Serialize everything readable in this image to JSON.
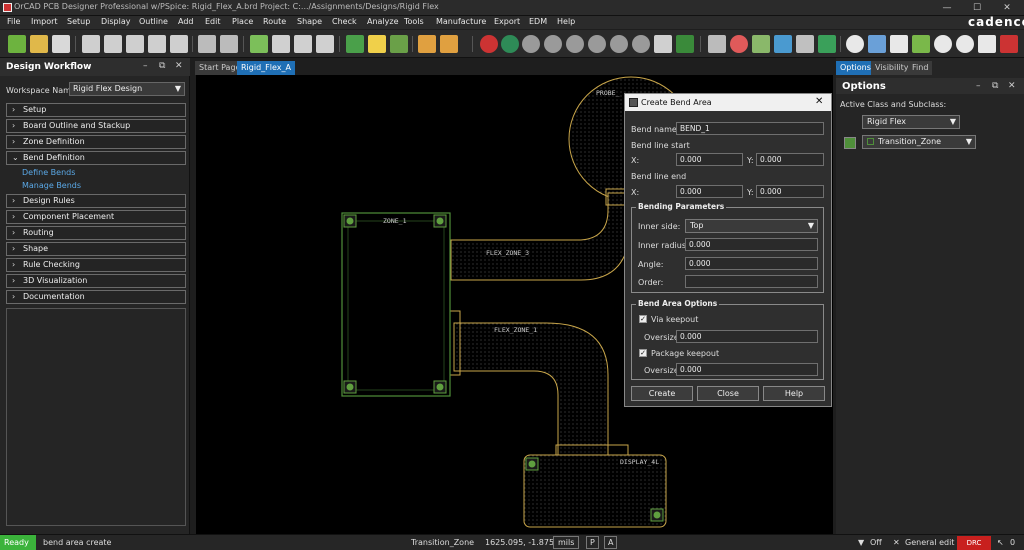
{
  "window": {
    "title": "OrCAD PCB Designer Professional w/PSpice: Rigid_Flex_A.brd  Project: C:.../Assignments/Designs/Rigid Flex",
    "minimize": "—",
    "maximize": "☐",
    "close": "✕"
  },
  "menu": [
    "File",
    "Import",
    "Setup",
    "Display",
    "Outline",
    "Add",
    "Edit",
    "Place",
    "Route",
    "Shape",
    "Check",
    "Analyze",
    "Tools",
    "Manufacture",
    "Export",
    "EDM",
    "Help"
  ],
  "brand": "cadence",
  "left_panel": {
    "title": "Design Workflow",
    "workspace_label": "Workspace Name:",
    "workspace_value": "Rigid Flex Design",
    "items": [
      {
        "label": "Setup",
        "chevron": "›"
      },
      {
        "label": "Board Outline and Stackup",
        "chevron": "›"
      },
      {
        "label": "Zone Definition",
        "chevron": "›"
      },
      {
        "label": "Bend Definition",
        "chevron": "⌄"
      },
      {
        "label": "Design Rules",
        "chevron": "›"
      },
      {
        "label": "Component Placement",
        "chevron": "›"
      },
      {
        "label": "Routing",
        "chevron": "›"
      },
      {
        "label": "Shape",
        "chevron": "›"
      },
      {
        "label": "Rule Checking",
        "chevron": "›"
      },
      {
        "label": "3D Visualization",
        "chevron": "›"
      },
      {
        "label": "Documentation",
        "chevron": "›"
      }
    ],
    "sub_items": [
      "Define Bends",
      "Manage Bends"
    ]
  },
  "tabs": [
    "Start Page",
    "Rigid_Flex_A"
  ],
  "canvas": {
    "labels": [
      "ZONE_1",
      "FLEX_ZONE_3",
      "FLEX_ZONE_1",
      "PROBE_",
      "DISPLAY_4L"
    ]
  },
  "right_panel": {
    "tabs": [
      "Options",
      "Visibility",
      "Find"
    ],
    "title": "Options",
    "active_class_label": "Active Class and Subclass:",
    "class_value": "Rigid Flex",
    "subclass_value": "Transition_Zone"
  },
  "dialog": {
    "title": "Create Bend Area",
    "bend_name_label": "Bend name:",
    "bend_name_value": "BEND_1",
    "line_start_label": "Bend line start",
    "line_end_label": "Bend line end",
    "x_label": "X:",
    "y_label": "Y:",
    "start_x": "0.000",
    "start_y": "0.000",
    "end_x": "0.000",
    "end_y": "0.000",
    "bending_group": "Bending Parameters",
    "inner_side_label": "Inner side:",
    "inner_side_value": "Top",
    "inner_radius_label": "Inner radius:",
    "inner_radius_value": "0.000",
    "angle_label": "Angle:",
    "angle_value": "0.000",
    "order_label": "Order:",
    "order_value": "",
    "options_group": "Bend Area Options",
    "via_keepout_label": "Via keepout",
    "via_oversize_label": "Oversize:",
    "via_oversize_value": "0.000",
    "pkg_keepout_label": "Package keepout",
    "pkg_oversize_label": "Oversize:",
    "pkg_oversize_value": "0.000",
    "check_mark": "✓",
    "buttons": [
      "Create",
      "Close",
      "Help"
    ]
  },
  "status": {
    "ready": "Ready",
    "command": "bend area create",
    "subclass": "Transition_Zone",
    "coords": "1625.095, -1.875",
    "units": "mils",
    "p": "P",
    "a": "A",
    "filter": "Off",
    "mode": "General edit",
    "drc": "DRC",
    "count": "0"
  },
  "colors": {
    "ready_bg": "#3bb33b",
    "outline": "#c9a64a",
    "zone_green": "#4f8f3a",
    "accent_tab": "#1f6fb5",
    "drc": "#c8201e"
  }
}
